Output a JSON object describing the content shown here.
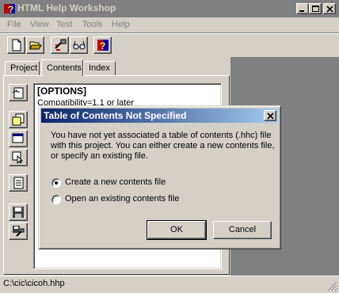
{
  "window": {
    "title": "HTML Help Workshop"
  },
  "menu": [
    "File",
    "View",
    "Test",
    "Tools",
    "Help"
  ],
  "tabs": [
    "Project",
    "Contents",
    "Index"
  ],
  "editor": {
    "lines": [
      "[OPTIONS]",
      "Compatibility=1.1 or later"
    ]
  },
  "status": {
    "path": "C:\\cic\\cicoh.hhp"
  },
  "dialog": {
    "title": "Table of Contents Not Specified",
    "message": "You have not yet associated a table of contents (.hhc) file with this project. You can either create a new contents file, or specify an existing file.",
    "options": [
      "Create a new contents file",
      "Open an existing contents file"
    ],
    "selected_option": 0,
    "ok_label": "OK",
    "cancel_label": "Cancel"
  }
}
